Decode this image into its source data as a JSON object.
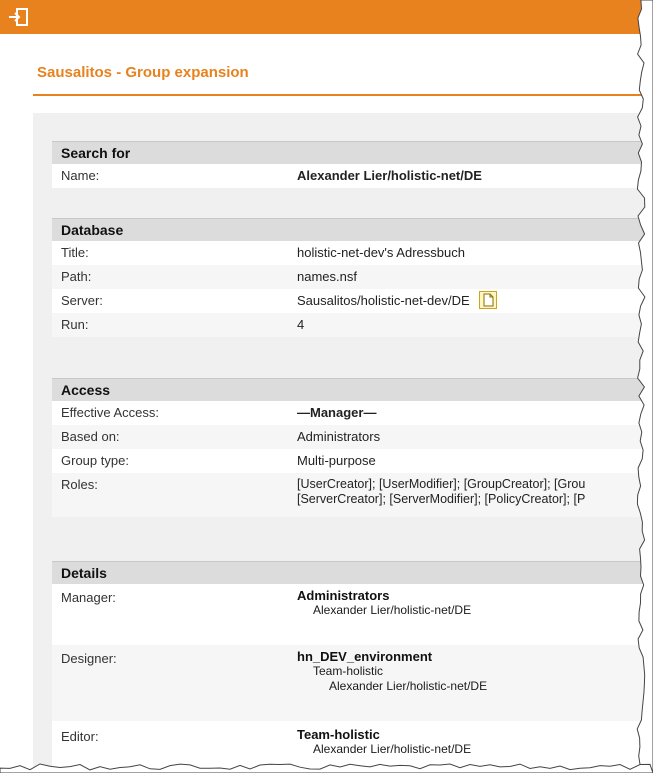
{
  "page": {
    "title": "Sausalitos - Group expansion"
  },
  "colors": {
    "accent": "#e8821e",
    "manager_red": "#e00000",
    "section_header": "#dcdcdc"
  },
  "icons": {
    "exit": "exit-door-icon",
    "server_doc": "document-icon"
  },
  "search_for": {
    "header": "Search for",
    "name_label": "Name:",
    "name_value": "Alexander Lier/holistic-net/DE"
  },
  "database": {
    "header": "Database",
    "title_label": "Title:",
    "title_value": "holistic-net-dev's Adressbuch",
    "path_label": "Path:",
    "path_value": "names.nsf",
    "server_label": "Server:",
    "server_value": "Sausalitos/holistic-net-dev/DE",
    "run_label": "Run:",
    "run_value": "4"
  },
  "access": {
    "header": "Access",
    "effective_label": "Effective Access:",
    "effective_value": "—Manager—",
    "based_label": "Based on:",
    "based_value": "Administrators",
    "grouptype_label": "Group type:",
    "grouptype_value": "Multi-purpose",
    "roles_label": "Roles:",
    "roles_line1": "[UserCreator]; [UserModifier]; [GroupCreator]; [Grou",
    "roles_line2": "[ServerCreator]; [ServerModifier]; [PolicyCreator]; [P"
  },
  "details": {
    "header": "Details",
    "manager_label": "Manager:",
    "manager_group": "Administrators",
    "manager_member": "Alexander Lier/holistic-net/DE",
    "designer_label": "Designer:",
    "designer_group": "hn_DEV_environment",
    "designer_sub": "Team-holistic",
    "designer_member": "Alexander Lier/holistic-net/DE",
    "editor_label": "Editor:",
    "editor_group": "Team-holistic",
    "editor_member": "Alexander Lier/holistic-net/DE"
  }
}
